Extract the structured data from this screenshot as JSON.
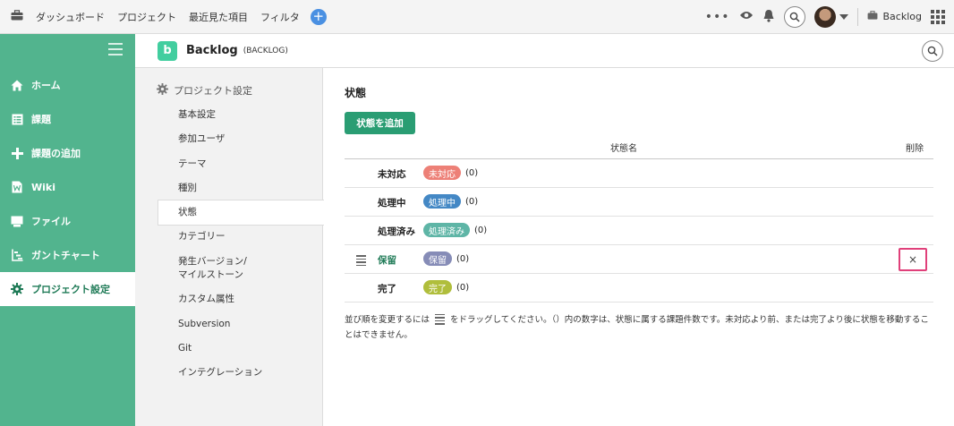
{
  "topbar": {
    "nav": [
      "ダッシュボード",
      "プロジェクト",
      "最近見た項目",
      "フィルタ"
    ],
    "plus": "+",
    "more": "•••",
    "space_name": "Backlog"
  },
  "sidebar": {
    "items": [
      {
        "label": "ホーム",
        "icon": "home-icon"
      },
      {
        "label": "課題",
        "icon": "list-icon"
      },
      {
        "label": "課題の追加",
        "icon": "plus-icon"
      },
      {
        "label": "Wiki",
        "icon": "wiki-icon"
      },
      {
        "label": "ファイル",
        "icon": "folder-icon"
      },
      {
        "label": "ガントチャート",
        "icon": "gantt-icon"
      },
      {
        "label": "プロジェクト設定",
        "icon": "gear-icon",
        "active": true
      }
    ]
  },
  "project": {
    "logo": "b",
    "name": "Backlog",
    "key": "(BACKLOG)"
  },
  "settings": {
    "title": "プロジェクト設定",
    "items": [
      "基本設定",
      "参加ユーザ",
      "テーマ",
      "種別",
      "状態",
      "カテゴリー",
      "発生バージョン/\nマイルストーン",
      "カスタム属性",
      "Subversion",
      "Git",
      "インテグレーション"
    ],
    "active": "状態"
  },
  "main": {
    "title": "状態",
    "add_button": "状態を追加",
    "col_name": "状態名",
    "col_delete": "削除",
    "rows": [
      {
        "name": "未対応",
        "badge": "未対応",
        "count": "(0)",
        "color": "#ed8077"
      },
      {
        "name": "処理中",
        "badge": "処理中",
        "count": "(0)",
        "color": "#4488c5"
      },
      {
        "name": "処理済み",
        "badge": "処理済み",
        "count": "(0)",
        "color": "#5eb5a6"
      },
      {
        "name": "保留",
        "badge": "保留",
        "count": "(0)",
        "color": "#868cb7",
        "custom": true
      },
      {
        "name": "完了",
        "badge": "完了",
        "count": "(0)",
        "color": "#b0be3c"
      }
    ],
    "delete_symbol": "×",
    "note_before": "並び順を変更するには",
    "note_after": "をドラッグしてください。（）内の数字は、状態に属する課題件数です。未対応より前、または完了より後に状態を移動することはできません。"
  }
}
